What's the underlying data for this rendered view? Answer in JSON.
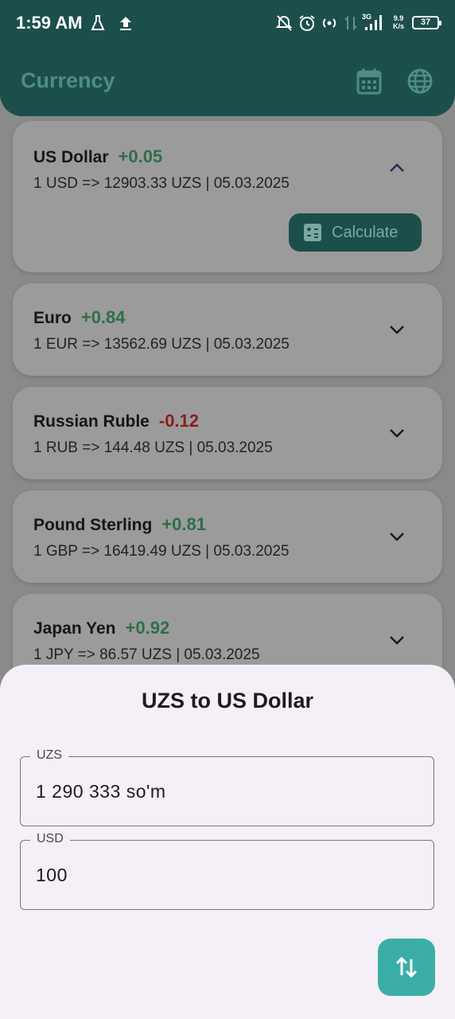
{
  "status": {
    "time": "1:59 AM",
    "net_top": "9.9",
    "net_bottom": "K/s",
    "battery": "37"
  },
  "appbar": {
    "title": "Currency",
    "calendar_icon": "calendar-icon",
    "globe_icon": "globe-icon"
  },
  "currencies": [
    {
      "name": "US Dollar",
      "change": "+0.05",
      "rate": "1 USD => 12903.33 UZS |  05.03.2025",
      "expanded": true
    },
    {
      "name": "Euro",
      "change": "+0.84",
      "rate": "1 EUR => 13562.69 UZS |  05.03.2025",
      "expanded": false
    },
    {
      "name": "Russian Ruble",
      "change": "-0.12",
      "rate": "1 RUB => 144.48 UZS |  05.03.2025",
      "expanded": false
    },
    {
      "name": "Pound Sterling",
      "change": "+0.81",
      "rate": "1 GBP => 16419.49 UZS |  05.03.2025",
      "expanded": false
    },
    {
      "name": "Japan Yen",
      "change": "+0.92",
      "rate": "1 JPY => 86.57 UZS |  05.03.2025",
      "expanded": false
    }
  ],
  "calculate_label": "Calculate",
  "sheet": {
    "title": "UZS to US Dollar",
    "from_label": "UZS",
    "from_value": "1 290 333 so'm",
    "to_label": "USD",
    "to_value": "100",
    "swap_icon": "swap-vert-icon"
  },
  "colors": {
    "primary": "#1c4f4b",
    "positive": "#2e6e4a",
    "negative": "#8b1d1d",
    "fab": "#3aaea6",
    "sheet_bg": "#f5eff7"
  }
}
